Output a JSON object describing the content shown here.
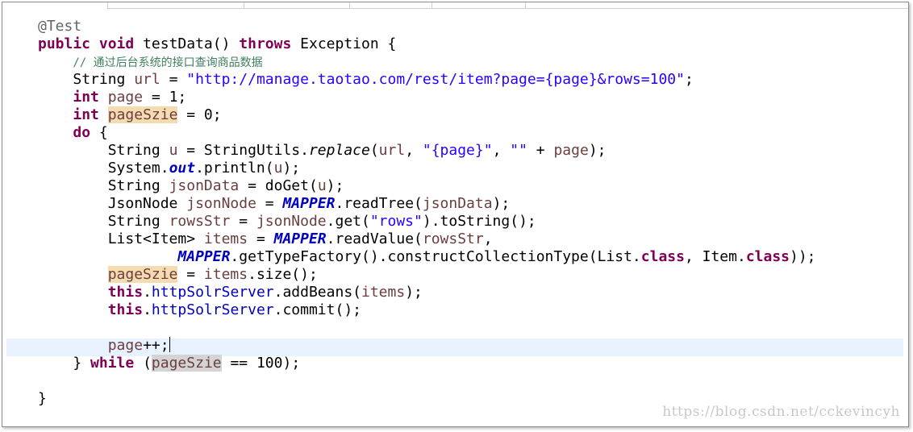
{
  "code": {
    "l01": {
      "anno": "@Test"
    },
    "l02": {
      "kw_public": "public",
      "kw_void": "void",
      "method_sig": " testData() ",
      "kw_throws": "throws",
      "rest": " Exception {"
    },
    "l03": {
      "comment": "// 通过后台系统的接口查询商品数据"
    },
    "l04": {
      "type": "String ",
      "var": "url",
      "eq": " = ",
      "str": "\"http://manage.taotao.com/rest/item?page={page}&rows=100\"",
      "end": ";"
    },
    "l05": {
      "kw": "int",
      "sp": " ",
      "var": "page",
      "rest": " = 1;"
    },
    "l06": {
      "kw": "int",
      "sp": " ",
      "var": "pageSzie",
      "rest": " = 0;"
    },
    "l07": {
      "kw": "do",
      "rest": " {"
    },
    "l08": {
      "a": "String ",
      "var": "u",
      "b": " = StringUtils.",
      "meth": "replace",
      "c": "(",
      "arg1": "url",
      "d": ", ",
      "str1": "\"{page}\"",
      "e": ", ",
      "str2": "\"\"",
      "f": " + ",
      "arg2": "page",
      "g": ");"
    },
    "l09": {
      "a": "System.",
      "fld": "out",
      "b": ".println(",
      "arg": "u",
      "c": ");"
    },
    "l10": {
      "a": "String ",
      "var": "jsonData",
      "b": " = doGet(",
      "arg": "u",
      "c": ");"
    },
    "l11": {
      "a": "JsonNode ",
      "var": "jsonNode",
      "b": " = ",
      "sfld": "MAPPER",
      "c": ".readTree(",
      "arg": "jsonData",
      "d": ");"
    },
    "l12": {
      "a": "String ",
      "var": "rowsStr",
      "b": " = ",
      "arg": "jsonNode",
      "c": ".get(",
      "str": "\"rows\"",
      "d": ").toString();"
    },
    "l13": {
      "a": "List<Item> ",
      "var": "items",
      "b": " = ",
      "sfld": "MAPPER",
      "c": ".readValue(",
      "arg": "rowsStr",
      "d": ","
    },
    "l14": {
      "sfld": "MAPPER",
      "a": ".getTypeFactory().constructCollectionType(List.",
      "kw1": "class",
      "b": ", Item.",
      "kw2": "class",
      "c": "));"
    },
    "l15": {
      "var": "pageSzie",
      "a": " = ",
      "arg": "items",
      "b": ".size();"
    },
    "l16": {
      "kw": "this",
      "a": ".",
      "fld": "httpSolrServer",
      "b": ".addBeans(",
      "arg": "items",
      "c": ");"
    },
    "l17": {
      "kw": "this",
      "a": ".",
      "fld": "httpSolrServer",
      "b": ".commit();"
    },
    "l19": {
      "var": "page",
      "rest": "++;"
    },
    "l20": {
      "a": "} ",
      "kw": "while",
      "b": " (",
      "var": "pageSzie",
      "c": " == 100);"
    },
    "l22": {
      "brace": "}"
    }
  },
  "watermark": "https://blog.csdn.net/cckevincyh"
}
